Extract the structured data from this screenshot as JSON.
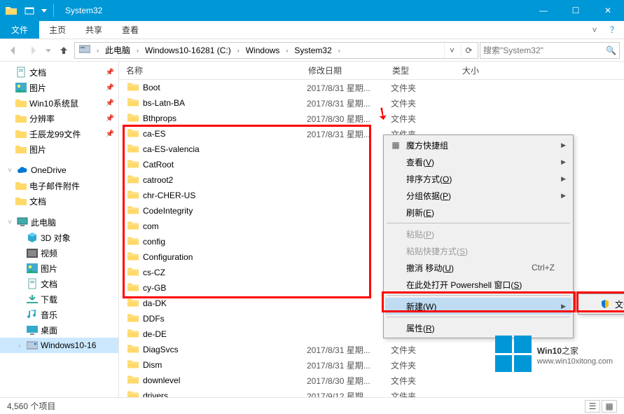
{
  "window": {
    "title": "System32",
    "min": "—",
    "max": "☐",
    "close": "✕"
  },
  "ribbon": {
    "file": "文件",
    "tabs": [
      "主页",
      "共享",
      "查看"
    ]
  },
  "breadcrumb": {
    "items": [
      "此电脑",
      "Windows10-16281 (C:)",
      "Windows",
      "System32"
    ]
  },
  "search": {
    "placeholder": "搜索\"System32\""
  },
  "nav": {
    "quick": [
      {
        "label": "文档",
        "icon": "doc",
        "pin": true
      },
      {
        "label": "图片",
        "icon": "pic",
        "pin": true
      },
      {
        "label": "Win10系统鼠",
        "icon": "folder",
        "pin": true
      },
      {
        "label": "分辨率",
        "icon": "folder",
        "pin": true
      },
      {
        "label": "壬辰龙99文件",
        "icon": "folder",
        "pin": true
      },
      {
        "label": "图片",
        "icon": "folder",
        "pin": false
      }
    ],
    "onedrive": {
      "label": "OneDrive",
      "children": [
        {
          "label": "电子邮件附件"
        },
        {
          "label": "文档"
        }
      ]
    },
    "thispc": {
      "label": "此电脑",
      "children": [
        {
          "label": "3D 对象",
          "icon": "3d"
        },
        {
          "label": "视频",
          "icon": "video"
        },
        {
          "label": "图片",
          "icon": "pic"
        },
        {
          "label": "文档",
          "icon": "doc"
        },
        {
          "label": "下载",
          "icon": "down"
        },
        {
          "label": "音乐",
          "icon": "music"
        },
        {
          "label": "桌面",
          "icon": "desk"
        },
        {
          "label": "Windows10-16",
          "icon": "disk",
          "sel": true
        }
      ]
    }
  },
  "columns": {
    "name": "名称",
    "date": "修改日期",
    "type": "类型",
    "size": "大小"
  },
  "files": [
    {
      "name": "Boot",
      "date": "2017/8/31 星期...",
      "type": "文件夹"
    },
    {
      "name": "bs-Latn-BA",
      "date": "2017/8/31 星期...",
      "type": "文件夹"
    },
    {
      "name": "Bthprops",
      "date": "2017/8/30 星期...",
      "type": "文件夹"
    },
    {
      "name": "ca-ES",
      "date": "2017/8/31 星期...",
      "type": "文件夹"
    },
    {
      "name": "ca-ES-valencia",
      "date": "",
      "type": ""
    },
    {
      "name": "CatRoot",
      "date": "",
      "type": ""
    },
    {
      "name": "catroot2",
      "date": "",
      "type": ""
    },
    {
      "name": "chr-CHER-US",
      "date": "",
      "type": ""
    },
    {
      "name": "CodeIntegrity",
      "date": "",
      "type": ""
    },
    {
      "name": "com",
      "date": "",
      "type": ""
    },
    {
      "name": "config",
      "date": "",
      "type": ""
    },
    {
      "name": "Configuration",
      "date": "",
      "type": ""
    },
    {
      "name": "cs-CZ",
      "date": "",
      "type": ""
    },
    {
      "name": "cy-GB",
      "date": "",
      "type": ""
    },
    {
      "name": "da-DK",
      "date": "",
      "type": ""
    },
    {
      "name": "DDFs",
      "date": "",
      "type": ""
    },
    {
      "name": "de-DE",
      "date": "",
      "type": ""
    },
    {
      "name": "DiagSvcs",
      "date": "2017/8/31 星期...",
      "type": "文件夹"
    },
    {
      "name": "Dism",
      "date": "2017/8/31 星期...",
      "type": "文件夹"
    },
    {
      "name": "downlevel",
      "date": "2017/8/30 星期...",
      "type": "文件夹"
    },
    {
      "name": "drivers",
      "date": "2017/9/12 星期...",
      "type": "文件夹"
    }
  ],
  "context_menu": {
    "items": [
      {
        "label": "魔方快捷组",
        "icon": "grid",
        "arrow": true
      },
      {
        "label": "查看(V)",
        "u": "V",
        "arrow": true
      },
      {
        "label": "排序方式(O)",
        "u": "O",
        "arrow": true
      },
      {
        "label": "分组依据(P)",
        "u": "P",
        "arrow": true
      },
      {
        "label": "刷新(E)",
        "u": "E"
      },
      {
        "sep": true
      },
      {
        "label": "粘贴(P)",
        "u": "P",
        "disabled": true
      },
      {
        "label": "粘贴快捷方式(S)",
        "u": "S",
        "disabled": true
      },
      {
        "label": "撤消 移动(U)",
        "u": "U",
        "shortcut": "Ctrl+Z"
      },
      {
        "label": "在此处打开 Powershell 窗口(S)",
        "u": "S"
      },
      {
        "sep": true
      },
      {
        "label": "新建(W)",
        "u": "W",
        "arrow": true,
        "hover": true
      },
      {
        "sep": true
      },
      {
        "label": "属性(R)",
        "u": "R"
      }
    ]
  },
  "submenu": {
    "label": "文件夹(F)",
    "u": "F",
    "icon": "shield"
  },
  "status": {
    "count": "4,560 个项目"
  },
  "watermark": {
    "brand_top": "Win10",
    "brand_suffix": "之家",
    "url": "www.win10xitong.com"
  }
}
